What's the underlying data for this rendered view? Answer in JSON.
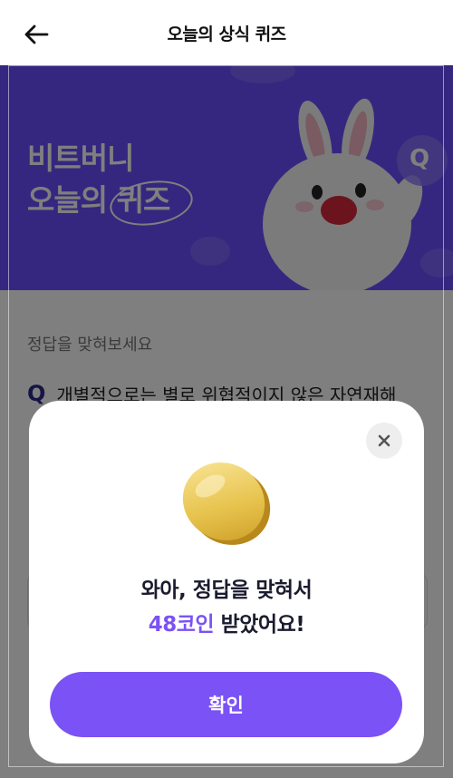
{
  "header": {
    "title": "오늘의 상식 퀴즈",
    "back_icon": "arrow-left-icon"
  },
  "banner": {
    "title_line1": "비트버니",
    "title_line2_prefix": "오늘의",
    "title_line2_word": "퀴즈",
    "mascot": "bunny-mascot",
    "badge_letter": "Q"
  },
  "question": {
    "label": "정답을 맞혀보세요",
    "marker": "Q",
    "text": "개별적으로는 별로 위협적이지 않은 자연재해"
  },
  "modal": {
    "close_icon": "close-icon",
    "coin_icon": "gold-coin-icon",
    "message_line1": "와아, 정답을 맞혀서",
    "reward_text": "48코인",
    "message_line2_suffix": " 받았어요!",
    "confirm_label": "확인"
  },
  "colors": {
    "primary": "#7b52f5",
    "banner": "#6a4fff",
    "overlay": "rgba(0,0,0,0.5)"
  }
}
